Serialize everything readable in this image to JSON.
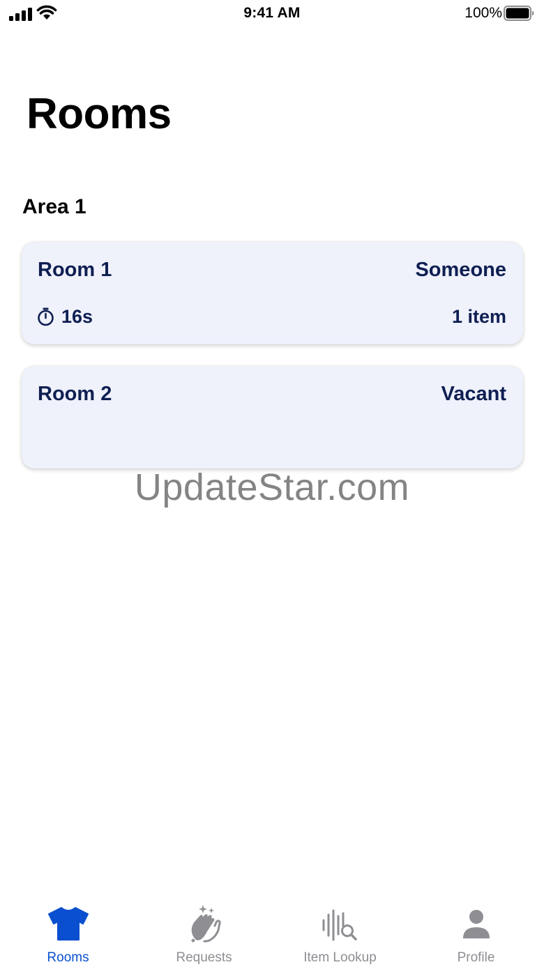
{
  "status_bar": {
    "time": "9:41 AM",
    "battery": "100%"
  },
  "page_title": "Rooms",
  "section": {
    "title": "Area 1"
  },
  "rooms": [
    {
      "name": "Room 1",
      "status": "Someone",
      "timer": "16s",
      "items": "1 item"
    },
    {
      "name": "Room 2",
      "status": "Vacant"
    }
  ],
  "watermark": "UpdateStar.com",
  "tab_bar": {
    "active": "Rooms",
    "tabs": [
      {
        "label": "Rooms",
        "icon": "shirt-icon"
      },
      {
        "label": "Requests",
        "icon": "clapping-hands-icon"
      },
      {
        "label": "Item Lookup",
        "icon": "waveform-search-icon"
      },
      {
        "label": "Profile",
        "icon": "person-icon"
      }
    ]
  },
  "colors": {
    "accent": "#0a4fcf",
    "card_bg": "#eff1fb",
    "card_text": "#0f1f52",
    "inactive": "#8e8e93"
  }
}
